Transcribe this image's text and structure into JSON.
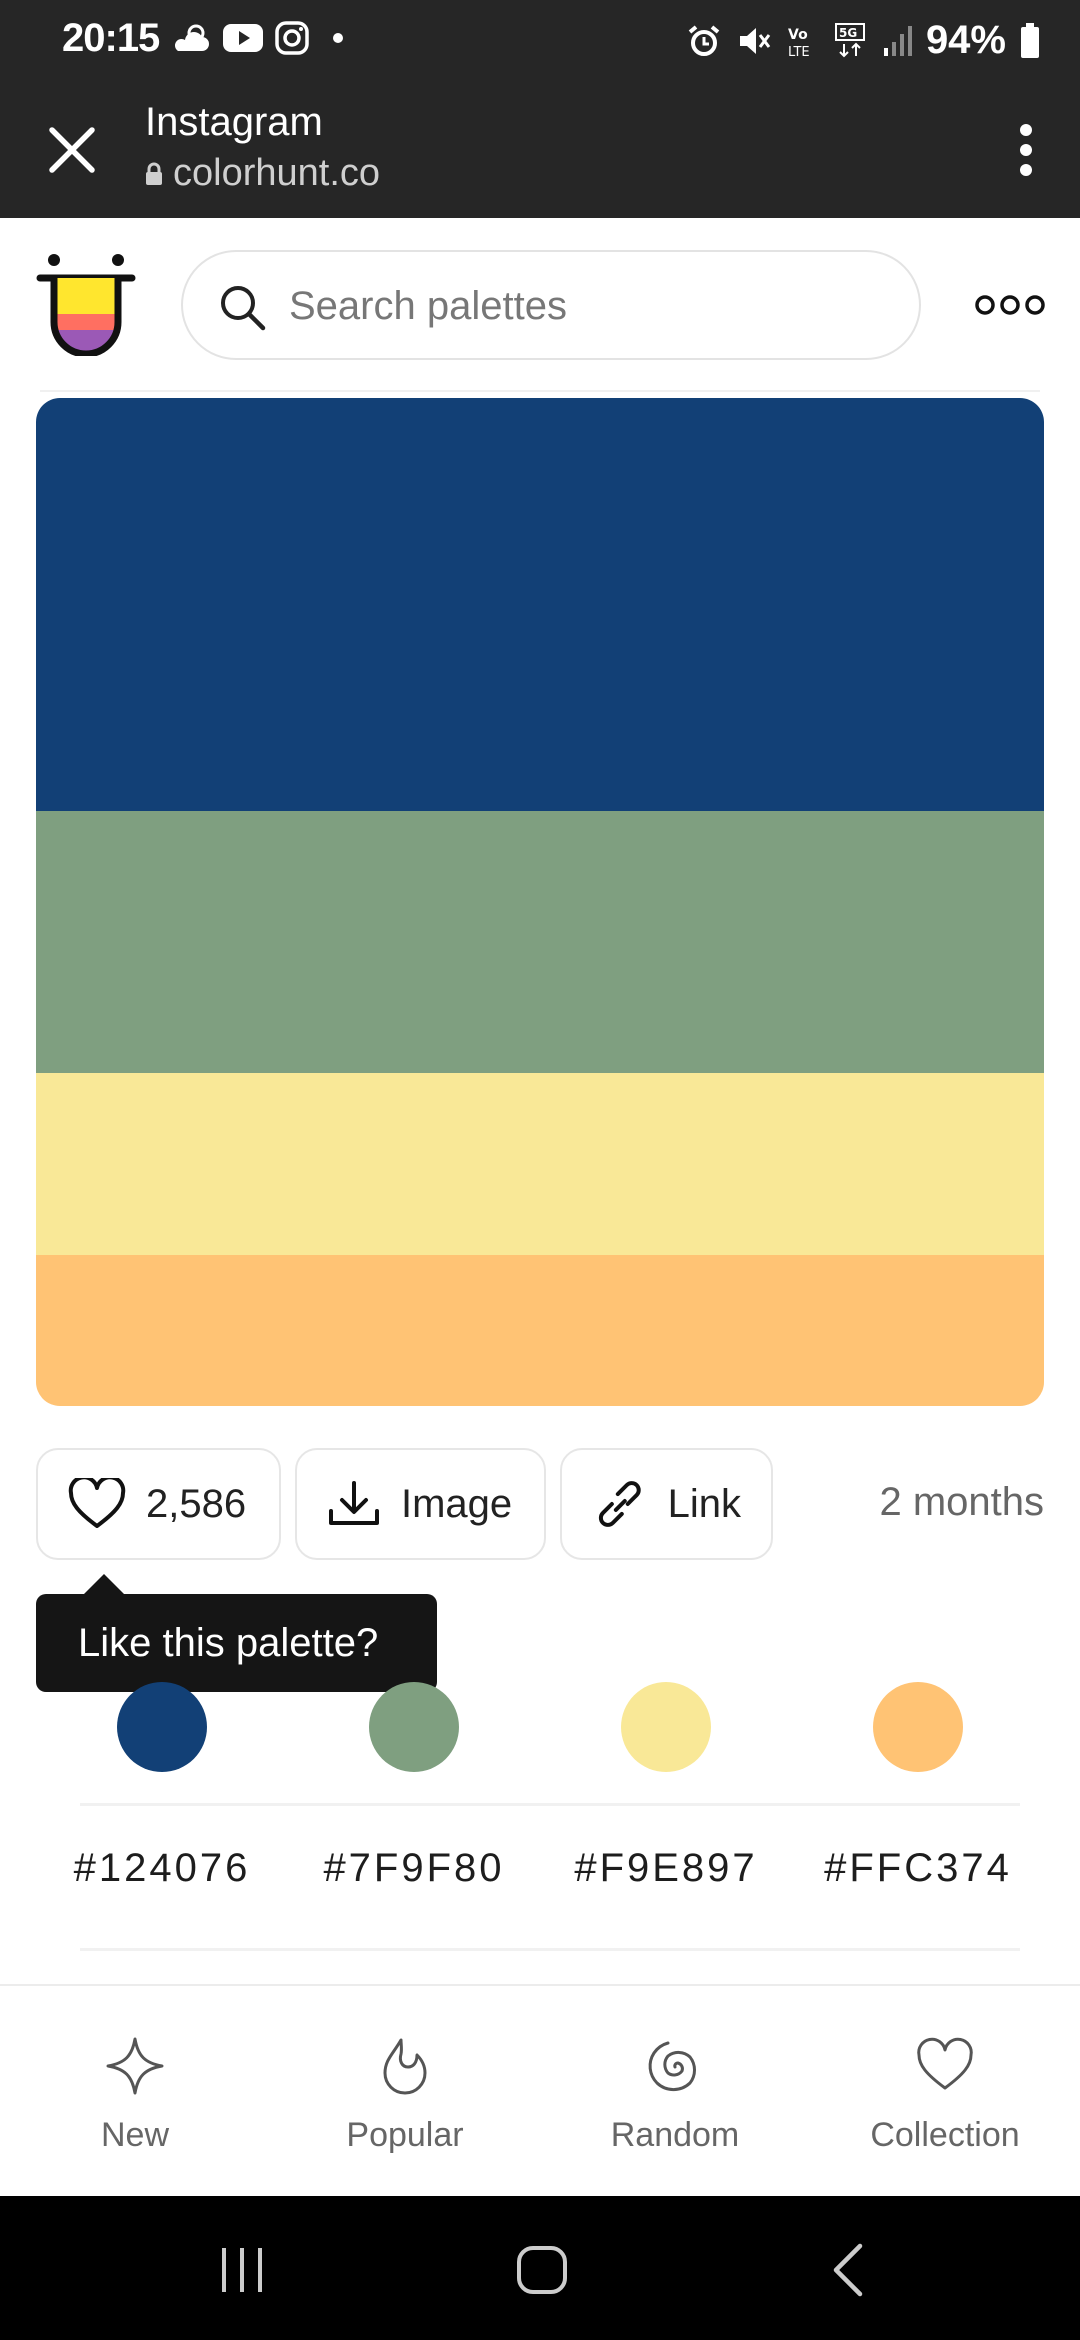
{
  "status_bar": {
    "time": "20:15",
    "battery_pct": "94%"
  },
  "browser": {
    "title": "Instagram",
    "url": "colorhunt.co"
  },
  "search": {
    "placeholder": "Search palettes"
  },
  "palette": {
    "colors": [
      "#124076",
      "#7F9F80",
      "#F9E897",
      "#FFC374"
    ]
  },
  "actions": {
    "likes": "2,586",
    "image_label": "Image",
    "link_label": "Link",
    "time_ago": "2 months"
  },
  "tooltip": {
    "text": "Like this palette?"
  },
  "codes": [
    "#124076",
    "#7F9F80",
    "#F9E897",
    "#FFC374"
  ],
  "bottom_nav": {
    "items": [
      {
        "label": "New",
        "icon": "sparkle-icon"
      },
      {
        "label": "Popular",
        "icon": "flame-icon"
      },
      {
        "label": "Random",
        "icon": "spiral-icon"
      },
      {
        "label": "Collection",
        "icon": "heart-icon"
      }
    ]
  }
}
